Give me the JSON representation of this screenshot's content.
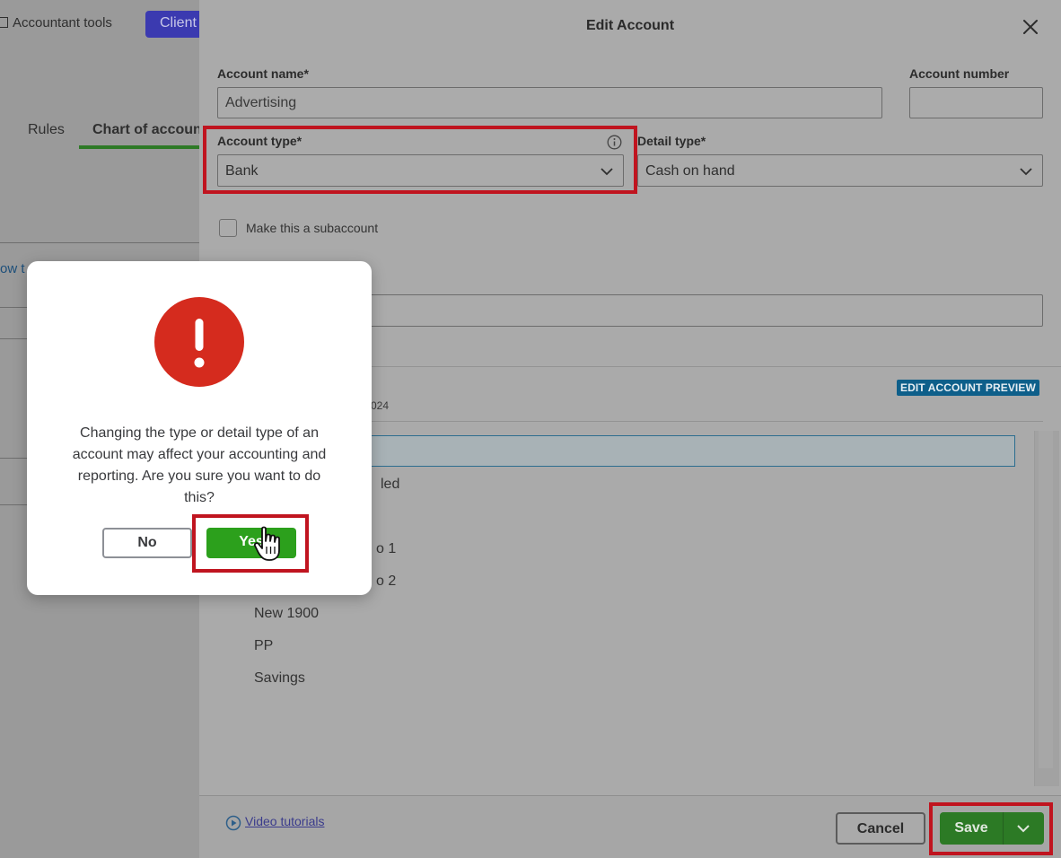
{
  "background": {
    "tools_label": "Accountant tools",
    "client_button": "Client",
    "tabs": [
      "Rules",
      "Chart of accounts"
    ],
    "link_fragment": "ow t"
  },
  "drawer": {
    "title": "Edit Account",
    "account_name": {
      "label": "Account name*",
      "value": "Advertising"
    },
    "account_number": {
      "label": "Account number",
      "value": ""
    },
    "account_type": {
      "label": "Account type*",
      "value": "Bank"
    },
    "detail_type": {
      "label": "Detail type*",
      "value": "Cash on hand"
    },
    "subaccount_label": "Make this a subaccount",
    "preview_badge": "EDIT ACCOUNT PREVIEW",
    "date_fragment": "024",
    "list_fragments": [
      "led",
      "o 1",
      "o 2"
    ],
    "list_items": [
      "New 1900",
      "PP",
      "Savings"
    ]
  },
  "footer": {
    "video_link": "Video tutorials",
    "cancel": "Cancel",
    "save": "Save"
  },
  "modal": {
    "message": "Changing the type or detail type of an account may affect your accounting and reporting. Are you sure you want to do this?",
    "no": "No",
    "yes": "Yes"
  },
  "colors": {
    "highlight": "#c0141f",
    "primary_green": "#2ca01c",
    "alert_red": "#d52b1e"
  },
  "icons": [
    "close-icon",
    "info-icon",
    "chevron-down-icon",
    "alert-exclamation-icon",
    "play-circle-icon",
    "hand-pointer-cursor-icon"
  ]
}
